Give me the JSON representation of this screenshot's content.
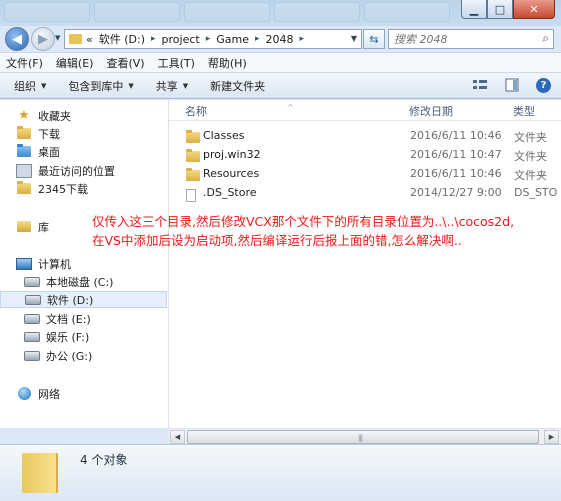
{
  "address": {
    "crumbs": [
      "«",
      "软件 (D:)",
      "project",
      "Game",
      "2048"
    ]
  },
  "search": {
    "placeholder": "搜索 2048"
  },
  "menu": [
    "文件(F)",
    "编辑(E)",
    "查看(V)",
    "工具(T)",
    "帮助(H)"
  ],
  "toolbar": {
    "organize": "组织",
    "include_library": "包含到库中",
    "share": "共享",
    "new_folder": "新建文件夹"
  },
  "nav": {
    "favorites": "收藏夹",
    "downloads": "下载",
    "desktop": "桌面",
    "recent": "最近访问的位置",
    "downloads2345": "2345下载",
    "libraries": "库",
    "computer": "计算机",
    "drive_c": "本地磁盘 (C:)",
    "drive_d": "软件 (D:)",
    "drive_e": "文档 (E:)",
    "drive_f": "娱乐 (F:)",
    "drive_g": "办公 (G:)",
    "network": "网络"
  },
  "columns": {
    "name": "名称",
    "date": "修改日期",
    "type": "类型"
  },
  "files": [
    {
      "name": "Classes",
      "date": "2016/6/11 10:46",
      "type": "文件夹",
      "icon": "folder-icon"
    },
    {
      "name": "proj.win32",
      "date": "2016/6/11 10:47",
      "type": "文件夹",
      "icon": "folder-icon"
    },
    {
      "name": "Resources",
      "date": "2016/6/11 10:46",
      "type": "文件夹",
      "icon": "folder-icon"
    },
    {
      "name": ".DS_Store",
      "date": "2014/12/27 9:00",
      "type": "DS_STO",
      "icon": "file-icon"
    }
  ],
  "annotation": {
    "line1": "仅传入这三个目录,然后修改VCX那个文件下的所有目录位置为..\\..\\cocos2d,",
    "line2": "在VS中添加后设为启动项,然后编译运行后报上面的错,怎么解决啊.."
  },
  "details": {
    "count": "4 个对象"
  },
  "colors": {
    "annotation": "#f01818",
    "selection": "#e5eefa"
  }
}
